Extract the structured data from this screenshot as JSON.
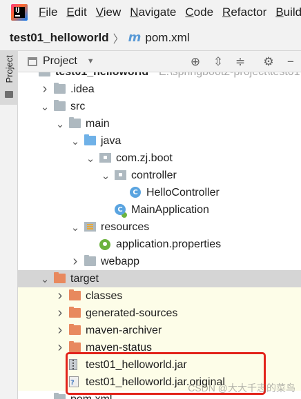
{
  "menubar": {
    "items": [
      {
        "label": "File",
        "u": 0
      },
      {
        "label": "Edit",
        "u": 0
      },
      {
        "label": "View",
        "u": 0
      },
      {
        "label": "Navigate",
        "u": 0
      },
      {
        "label": "Code",
        "u": 0
      },
      {
        "label": "Refactor",
        "u": 0
      },
      {
        "label": "Build",
        "u": 0
      }
    ]
  },
  "breadcrumb": {
    "project": "test01_helloworld",
    "separator": "〉",
    "file": "pom.xml",
    "file_icon": "maven-m-icon"
  },
  "side_tab": {
    "label": "Project"
  },
  "tool_window": {
    "title": "Project",
    "tools": [
      "locate-icon",
      "expand-all-icon",
      "collapse-all-icon",
      "gear-icon",
      "hide-icon"
    ]
  },
  "tree": {
    "rows": [
      {
        "label": "test01_helloworld",
        "suffix": "E:\\springboot2-project\\test01",
        "icon": "module-folder-icon",
        "depth": 0,
        "expander": "none",
        "state": "normal",
        "partial": true
      },
      {
        "label": ".idea",
        "icon": "folder-icon",
        "depth": 1,
        "expander": "collapsed",
        "state": "normal"
      },
      {
        "label": "src",
        "icon": "folder-icon",
        "depth": 1,
        "expander": "expanded",
        "state": "normal"
      },
      {
        "label": "main",
        "icon": "folder-icon",
        "depth": 2,
        "expander": "expanded",
        "state": "normal"
      },
      {
        "label": "java",
        "icon": "source-folder-icon",
        "depth": 3,
        "expander": "expanded",
        "state": "normal"
      },
      {
        "label": "com.zj.boot",
        "icon": "package-icon",
        "depth": 4,
        "expander": "expanded",
        "state": "normal"
      },
      {
        "label": "controller",
        "icon": "package-icon",
        "depth": 5,
        "expander": "expanded",
        "state": "normal"
      },
      {
        "label": "HelloController",
        "icon": "class-icon",
        "depth": 6,
        "expander": "none",
        "state": "normal"
      },
      {
        "label": "MainApplication",
        "icon": "spring-boot-class-icon",
        "depth": 5,
        "expander": "none",
        "state": "normal"
      },
      {
        "label": "resources",
        "icon": "resources-folder-icon",
        "depth": 3,
        "expander": "expanded",
        "state": "normal"
      },
      {
        "label": "application.properties",
        "icon": "spring-properties-icon",
        "depth": 4,
        "expander": "none",
        "state": "normal"
      },
      {
        "label": "webapp",
        "icon": "folder-icon",
        "depth": 3,
        "expander": "collapsed",
        "state": "normal"
      },
      {
        "label": "target",
        "icon": "excluded-folder-icon",
        "depth": 1,
        "expander": "expanded",
        "state": "selected"
      },
      {
        "label": "classes",
        "icon": "excluded-folder-icon",
        "depth": 2,
        "expander": "collapsed",
        "state": "excluded"
      },
      {
        "label": "generated-sources",
        "icon": "excluded-folder-icon",
        "depth": 2,
        "expander": "collapsed",
        "state": "excluded"
      },
      {
        "label": "maven-archiver",
        "icon": "excluded-folder-icon",
        "depth": 2,
        "expander": "collapsed",
        "state": "excluded"
      },
      {
        "label": "maven-status",
        "icon": "excluded-folder-icon",
        "depth": 2,
        "expander": "collapsed",
        "state": "excluded"
      },
      {
        "label": "test01_helloworld.jar",
        "icon": "jar-icon",
        "depth": 2,
        "expander": "none",
        "state": "excluded"
      },
      {
        "label": "test01_helloworld.jar.original",
        "icon": "unknown-file-icon",
        "depth": 2,
        "expander": "none",
        "state": "excluded"
      },
      {
        "label": "pom.xml",
        "icon": "maven-file-icon",
        "depth": 1,
        "expander": "none",
        "state": "normal",
        "partial": true
      }
    ]
  },
  "annotation": {
    "color": "#e2231a"
  },
  "watermark": "CSDN @大大千志的菜鸟",
  "colors": {
    "chrome_bg": "#f2f2f2",
    "selection_bg": "#d5d5d5",
    "excluded_bg": "#fdfde8",
    "excluded_folder": "#e8895e",
    "source_folder": "#6fb1e7",
    "folder": "#aeb9c0"
  }
}
